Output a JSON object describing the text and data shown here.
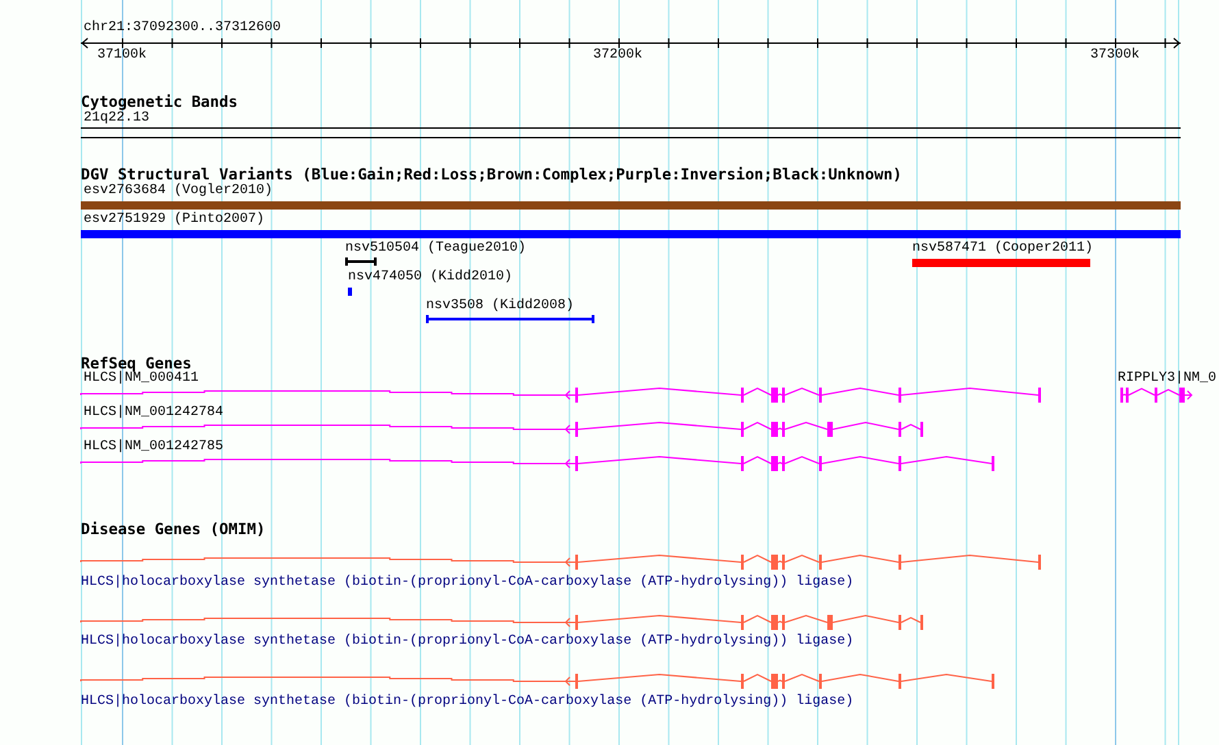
{
  "ruler": {
    "region": "chr21:37092300..37312600",
    "ticks": [
      "37100k",
      "37200k",
      "37300k"
    ]
  },
  "tracks": [
    {
      "kind": "bands",
      "title": "Cytogenetic Bands",
      "features": [
        {
          "label": "21q22.13"
        }
      ]
    },
    {
      "kind": "variants",
      "title": "DGV Structural Variants (Blue:Gain;Red:Loss;Brown:Complex;Purple:Inversion;Black:Unknown)",
      "features": [
        {
          "label": "esv2763684 (Vogler2010)",
          "color": "#8b4513"
        },
        {
          "label": "esv2751929 (Pinto2007)",
          "color": "#0000ff"
        },
        {
          "label": "nsv510504 (Teague2010)",
          "color": "#000000"
        },
        {
          "label": "nsv474050 (Kidd2010)",
          "color": "#0000ff"
        },
        {
          "label": "nsv3508 (Kidd2008)",
          "color": "#0000ff"
        },
        {
          "label": "nsv587471 (Cooper2011)",
          "color": "#ff0000"
        }
      ]
    },
    {
      "kind": "genes",
      "title": "RefSeq Genes",
      "features": [
        {
          "label": "HLCS|NM_000411"
        },
        {
          "label": "HLCS|NM_001242784"
        },
        {
          "label": "HLCS|NM_001242785"
        },
        {
          "label": "RIPPLY3|NM_0"
        }
      ]
    },
    {
      "kind": "disease",
      "title": "Disease Genes (OMIM)",
      "features": [
        {
          "label": "HLCS|holocarboxylase synthetase (biotin-(proprionyl-CoA-carboxylase (ATP-hydrolysing)) ligase)"
        },
        {
          "label": "HLCS|holocarboxylase synthetase (biotin-(proprionyl-CoA-carboxylase (ATP-hydrolysing)) ligase)"
        },
        {
          "label": "HLCS|holocarboxylase synthetase (biotin-(proprionyl-CoA-carboxylase (ATP-hydrolysing)) ligase)"
        }
      ]
    }
  ]
}
